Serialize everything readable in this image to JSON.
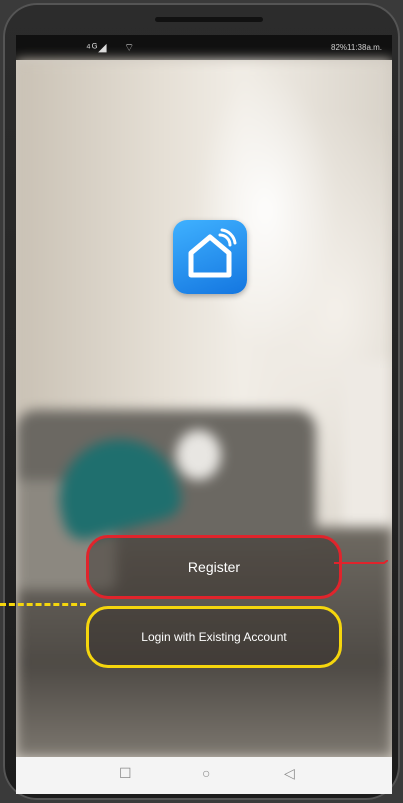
{
  "status": {
    "signal": "⁴ᴳ◢",
    "wifi": "⌔",
    "right": "82%11:38a.m."
  },
  "buttons": {
    "register": "Register",
    "login": "Login with Existing Account"
  },
  "nav": {
    "recent": "☐",
    "home": "○",
    "back": "◁"
  },
  "colors": {
    "register_highlight": "#e0242c",
    "login_highlight": "#f5d60d",
    "app_icon": "#1e8cf0"
  }
}
